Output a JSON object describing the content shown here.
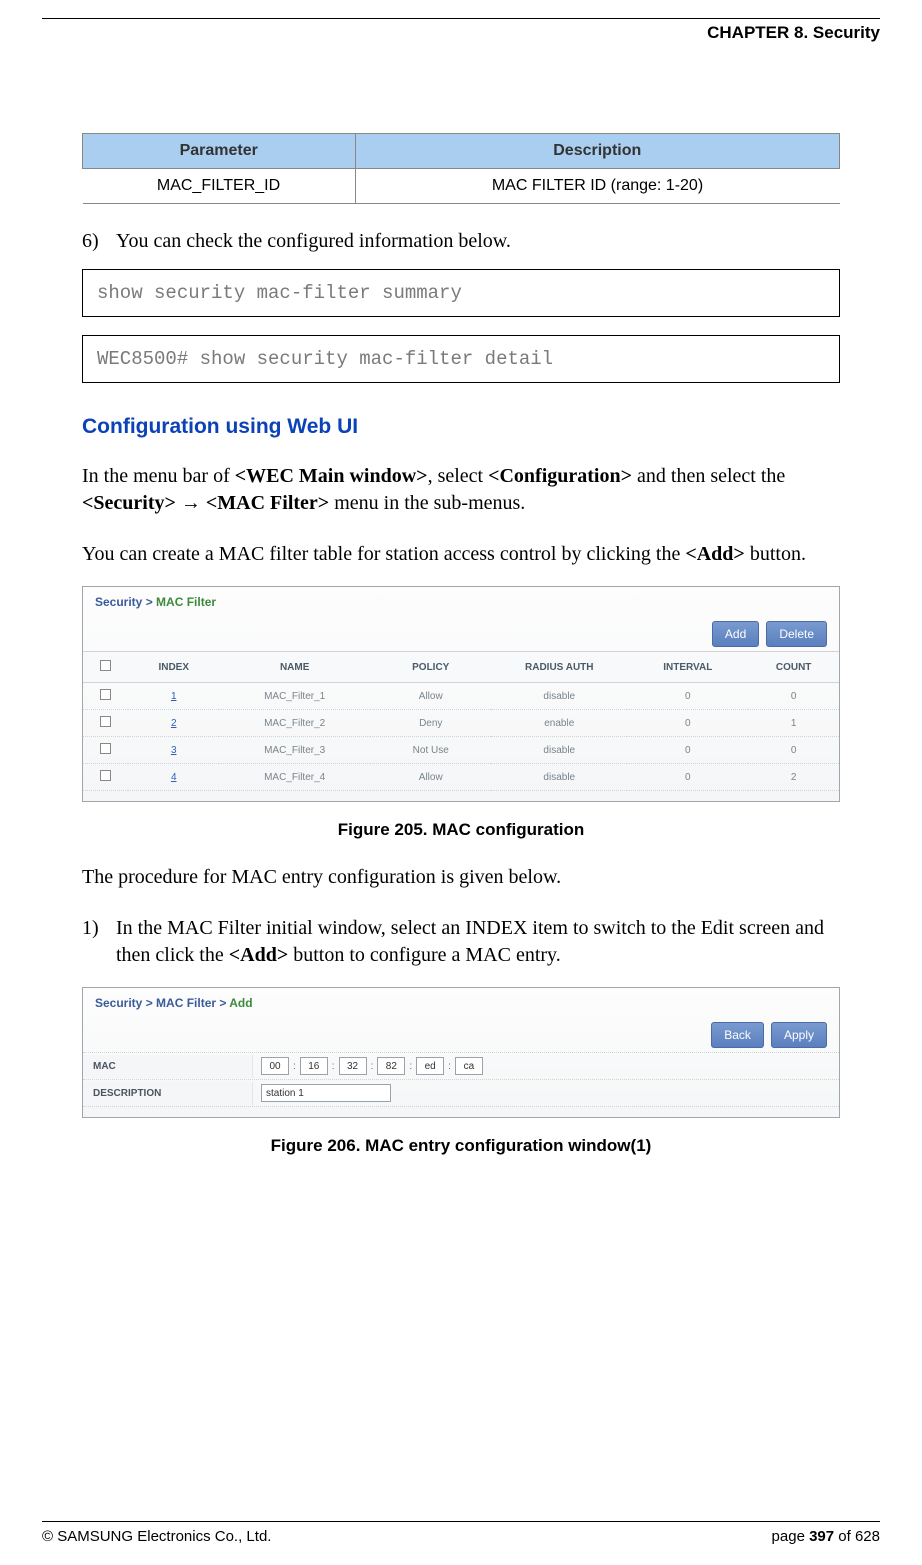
{
  "header": {
    "chapter": "CHAPTER 8. Security"
  },
  "paramTable": {
    "headers": {
      "param": "Parameter",
      "desc": "Description"
    },
    "rows": [
      {
        "param": "MAC_FILTER_ID",
        "desc": "MAC FILTER ID (range: 1-20)"
      }
    ]
  },
  "step6": {
    "num": "6)",
    "text": "You can check the configured information below."
  },
  "code1": "show security mac-filter summary",
  "code2": "WEC8500# show security mac-filter detail",
  "section": {
    "title": "Configuration using Web UI",
    "p1_a": "In the menu bar of ",
    "p1_b1": "<WEC Main window>",
    "p1_c": ", select ",
    "p1_b2": "<Configuration>",
    "p1_d": " and then select the ",
    "p1_b3": "<Security>",
    "p1_arrow": " → ",
    "p1_b4": "<MAC Filter>",
    "p1_e": " menu in the sub-menus.",
    "p2_a": "You can create a MAC filter table for station access control by clicking the ",
    "p2_b": "<Add>",
    "p2_c": " button."
  },
  "fig205": {
    "breadcrumb": {
      "a": "Security  >  ",
      "b": "MAC Filter"
    },
    "buttons": {
      "add": "Add",
      "del": "Delete"
    },
    "headers": {
      "chk": "",
      "index": "INDEX",
      "name": "NAME",
      "policy": "POLICY",
      "radius": "RADIUS AUTH",
      "interval": "INTERVAL",
      "count": "COUNT"
    },
    "rows": [
      {
        "index": "1",
        "name": "MAC_Filter_1",
        "policy": "Allow",
        "radius": "disable",
        "interval": "0",
        "count": "0"
      },
      {
        "index": "2",
        "name": "MAC_Filter_2",
        "policy": "Deny",
        "radius": "enable",
        "interval": "0",
        "count": "1"
      },
      {
        "index": "3",
        "name": "MAC_Filter_3",
        "policy": "Not Use",
        "radius": "disable",
        "interval": "0",
        "count": "0"
      },
      {
        "index": "4",
        "name": "MAC_Filter_4",
        "policy": "Allow",
        "radius": "disable",
        "interval": "0",
        "count": "2"
      }
    ],
    "caption": "Figure 205. MAC configuration"
  },
  "midText": "The procedure for MAC entry configuration is given below.",
  "step1": {
    "num": "1)",
    "a": "In the MAC Filter initial window, select an INDEX item to switch to the Edit screen and then click the ",
    "b": "<Add>",
    "c": " button to configure a MAC entry."
  },
  "fig206": {
    "breadcrumb": {
      "a": "Security  >  MAC Filter  >  ",
      "b": "Add"
    },
    "buttons": {
      "back": "Back",
      "apply": "Apply"
    },
    "rows": {
      "mac": {
        "label": "MAC",
        "octets": [
          "00",
          "16",
          "32",
          "82",
          "ed",
          "ca"
        ]
      },
      "desc": {
        "label": "DESCRIPTION",
        "value": "station 1"
      }
    },
    "caption": "Figure 206. MAC entry configuration window(1)"
  },
  "footer": {
    "copyright": "© SAMSUNG Electronics Co., Ltd.",
    "page_a": "page ",
    "page_b": "397",
    "page_c": " of 628"
  }
}
